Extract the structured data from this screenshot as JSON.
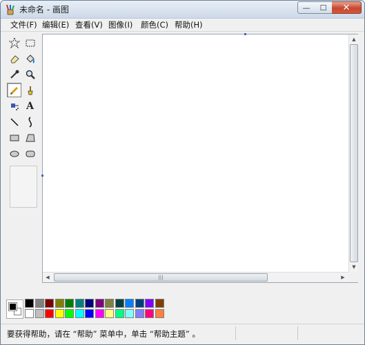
{
  "window": {
    "title": "未命名 - 画图",
    "app_icon": "paint-brush-cup-icon",
    "controls": {
      "minimize": "—",
      "maximize": "☐",
      "close": "✕"
    }
  },
  "menu": [
    {
      "label": "文件(F)"
    },
    {
      "label": "编辑(E)"
    },
    {
      "label": "查看(V)"
    },
    {
      "label": "图像(I)"
    },
    {
      "label": "颜色(C)"
    },
    {
      "label": "帮助(H)"
    }
  ],
  "tools": [
    {
      "name": "free-select",
      "icon": "free-form-select-icon",
      "glyph": "☆"
    },
    {
      "name": "rect-select",
      "icon": "rect-select-icon",
      "glyph": "⬚"
    },
    {
      "name": "eraser",
      "icon": "eraser-icon",
      "glyph": "◩"
    },
    {
      "name": "fill",
      "icon": "fill-bucket-icon",
      "glyph": "⛽"
    },
    {
      "name": "color-picker",
      "icon": "eyedropper-icon",
      "glyph": "✎"
    },
    {
      "name": "magnifier",
      "icon": "magnifier-icon",
      "glyph": "🔍"
    },
    {
      "name": "pencil",
      "icon": "pencil-icon",
      "glyph": "✏",
      "selected": true
    },
    {
      "name": "brush",
      "icon": "brush-icon",
      "glyph": "🖌"
    },
    {
      "name": "airbrush",
      "icon": "airbrush-icon",
      "glyph": "✈"
    },
    {
      "name": "text",
      "icon": "text-icon",
      "glyph": "A"
    },
    {
      "name": "line",
      "icon": "line-icon",
      "glyph": "╲"
    },
    {
      "name": "curve",
      "icon": "curve-icon",
      "glyph": "∫"
    },
    {
      "name": "rectangle",
      "icon": "rectangle-icon",
      "glyph": "▭"
    },
    {
      "name": "polygon",
      "icon": "polygon-icon",
      "glyph": "▱"
    },
    {
      "name": "ellipse",
      "icon": "ellipse-icon",
      "glyph": "⬭"
    },
    {
      "name": "rounded-rectangle",
      "icon": "rounded-rectangle-icon",
      "glyph": "▢"
    }
  ],
  "palette": {
    "foreground": "#000000",
    "background": "#ffffff",
    "row1": [
      "#000000",
      "#808080",
      "#800000",
      "#808000",
      "#008000",
      "#008080",
      "#000080",
      "#800080",
      "#808040",
      "#004040",
      "#0080ff",
      "#004080",
      "#8000ff",
      "#804000"
    ],
    "row2": [
      "#ffffff",
      "#c0c0c0",
      "#ff0000",
      "#ffff00",
      "#00ff00",
      "#00ffff",
      "#0000ff",
      "#ff00ff",
      "#ffff80",
      "#00ff80",
      "#80ffff",
      "#8080ff",
      "#ff0080",
      "#ff8040"
    ]
  },
  "status": {
    "text": "要获得帮助，请在 “帮助” 菜单中，单击 “帮助主题” 。"
  },
  "scroll": {
    "h_thumb_grip": "|||"
  }
}
